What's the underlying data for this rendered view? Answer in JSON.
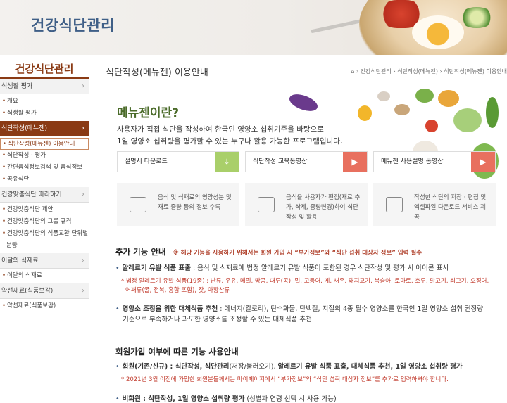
{
  "banner": {
    "title": "건강식단관리"
  },
  "sidebar": {
    "title": "건강식단관리",
    "groups": [
      {
        "label": "식생활 평가",
        "items": [
          "개요",
          "식생활 평가"
        ]
      },
      {
        "label": "식단작성(메뉴젠)",
        "items": [
          "식단작성(메뉴젠) 이용안내",
          "식단작성 · 평가",
          "간편음식정보검색 및 음식정보",
          "공유식단"
        ]
      },
      {
        "label": "건강맞춤식단 따라하기",
        "items": [
          "건강맞춤식단 제안",
          "건강맞춤식단의 그룹 규격",
          "건강맞춤식단의 식품교환 단위별",
          "분량"
        ]
      },
      {
        "label": "이달의 식재료",
        "items": [
          "이달의 식재료"
        ]
      },
      {
        "label": "약선재료(식품보감)",
        "items": [
          "약선재료(식품보감)"
        ]
      }
    ]
  },
  "content": {
    "heading": "식단작성(메뉴젠) 이용안내",
    "breadcrumb": [
      "건강식단관리",
      "식단작성(메뉴젠)",
      "식단작성(메뉴젠) 이용안내"
    ],
    "intro_title": "메뉴젠이란?",
    "intro_desc_1": "사용자가 직접 식단을 작성하여 한국인 영양소 섭취기준을 바탕으로",
    "intro_desc_2": "1일 영양소 섭취량을 평가할 수 있는 누구나 활용 가능한 프로그램입니다.",
    "buttons": [
      {
        "label": "설명서 다운로드",
        "icon": "download-icon"
      },
      {
        "label": "식단작성 교육동영상",
        "icon": "play-icon"
      },
      {
        "label": "메뉴젠 사용설명 동영상",
        "icon": "play-icon"
      }
    ],
    "features": [
      {
        "text": "음식 및 식재료의 영양성분 및 재료 중량 등의 정보 수록"
      },
      {
        "text": "음식을 사용자가 편집(재료 추가, 삭제, 중량변경)하여 식단작성 및 활용"
      },
      {
        "text": "작성한 식단의 저장 · 편집 및 엑셀파일 다운로드 서비스 제공"
      }
    ],
    "section1_title": "추가 기능 안내",
    "section1_note": "※ 해당 기능을 사용하기 위해서는 회원 가입 시 “부가정보”와 “식단 섭취 대상자 정보” 입력 필수",
    "allergy_label": "알레르기 유발 식품 표출",
    "allergy_text": " : 음식 및 식재료에 법정 알레르기 유발 식품이 포함된 경우 식단작성 및 평가 시 아이콘 표시",
    "allergy_red_1": "* 법정 알레르기 유발 식품(19종) : 난류, 우유, 메밀, 땅콩, 대두(콩), 밀, 고등어, 게, 새우, 돼지고기, 복숭아, 토마토, 호두, 닭고기, 쇠고기, 오징어,",
    "allergy_red_2": "어패류(굴, 전복, 홍합 포함), 잣, 아황산류",
    "subst_label": "영양소 조정을 위한 대체식품 추천",
    "subst_text_1": " : 에너지(칼로리), 탄수화물, 단백질, 지질의 4종 필수 영양소를 한국인 1일 영양소 섭취 권장량",
    "subst_text_2": "기준으로 부족하거나 과도한 영양소를 조정할 수 있는 대체식품 추천",
    "section2_title": "회원가입 여부에 따른 기능 사용안내",
    "member_label": "회원(기존/신규) : 식단작성, 식단관리",
    "member_mid": "(저장/불러오기), ",
    "member_bold2": "알레르기 유발 식품 표출, 대체식품 추천, 1일 영양소 섭취량 평가",
    "member_red": "* 2021년 3월 이전에 가입한 회원분들께서는 마이페이지에서 “부가정보”와 “식단 섭취 대상자 정보”를 추가로 입력하셔야 합니다.",
    "guest_label": "비회원 : 식단작성, 1일 영양소 섭취량 평가",
    "guest_text": " (성별과 연령 선택 시 사용 가능)"
  },
  "colors": {
    "brand_brown": "#8a3a14",
    "title_blue": "#3f5f87",
    "download_green": "#a9cf6a",
    "play_red": "#e8705f",
    "alert_red": "#c0392b"
  }
}
